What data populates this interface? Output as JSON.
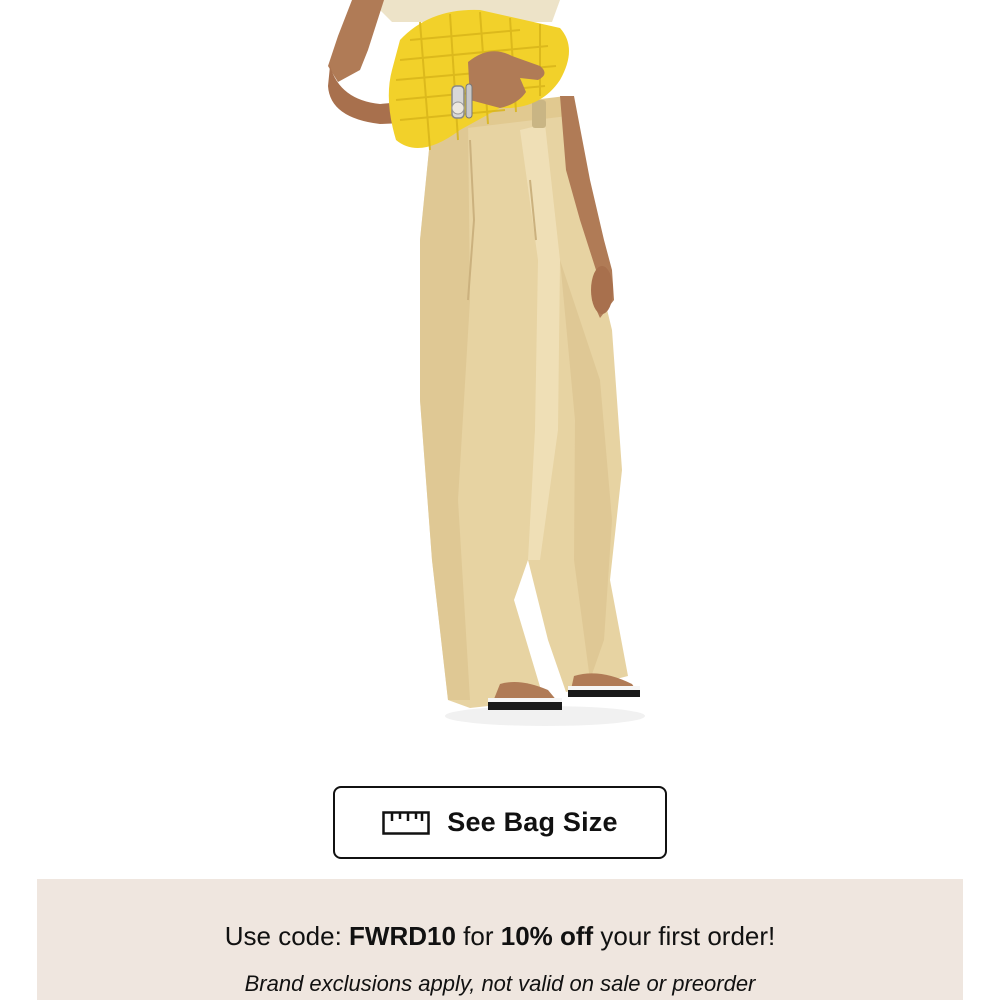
{
  "product": {
    "image_alt": "Model wearing wide-leg pleated trousers holding a woven yellow clutch"
  },
  "bag_size_button": {
    "icon": "ruler-icon",
    "label": "See Bag Size"
  },
  "promo": {
    "prefix": "Use code: ",
    "code": "FWRD10",
    "middle": " for ",
    "discount": "10% off",
    "suffix": " your first order!",
    "note": "Brand exclusions apply, not valid on sale or preorder",
    "background_color": "#efe6df"
  }
}
